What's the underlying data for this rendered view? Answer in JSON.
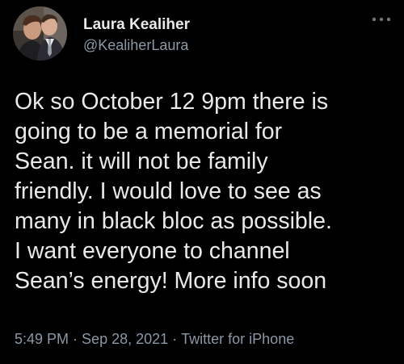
{
  "user": {
    "display_name": "Laura Kealiher",
    "handle": "@KealiherLaura",
    "avatar": "profile-photo"
  },
  "more_icon": "more-dots-icon",
  "tweet": {
    "lines": [
      "Ok so October 12 9pm there is",
      "going to be a memorial for",
      "Sean. it will not be family",
      "friendly. I would love to see as",
      "many in black bloc as possible.",
      "I want everyone to channel",
      "Sean’s energy! More info soon"
    ]
  },
  "meta": {
    "time": "5:49 PM",
    "separator": "·",
    "date": "Sep 28, 2021",
    "source": "Twitter for iPhone"
  },
  "colors": {
    "background": "#000000",
    "text_primary": "#e7e9ea",
    "text_secondary": "#8b98a5"
  }
}
